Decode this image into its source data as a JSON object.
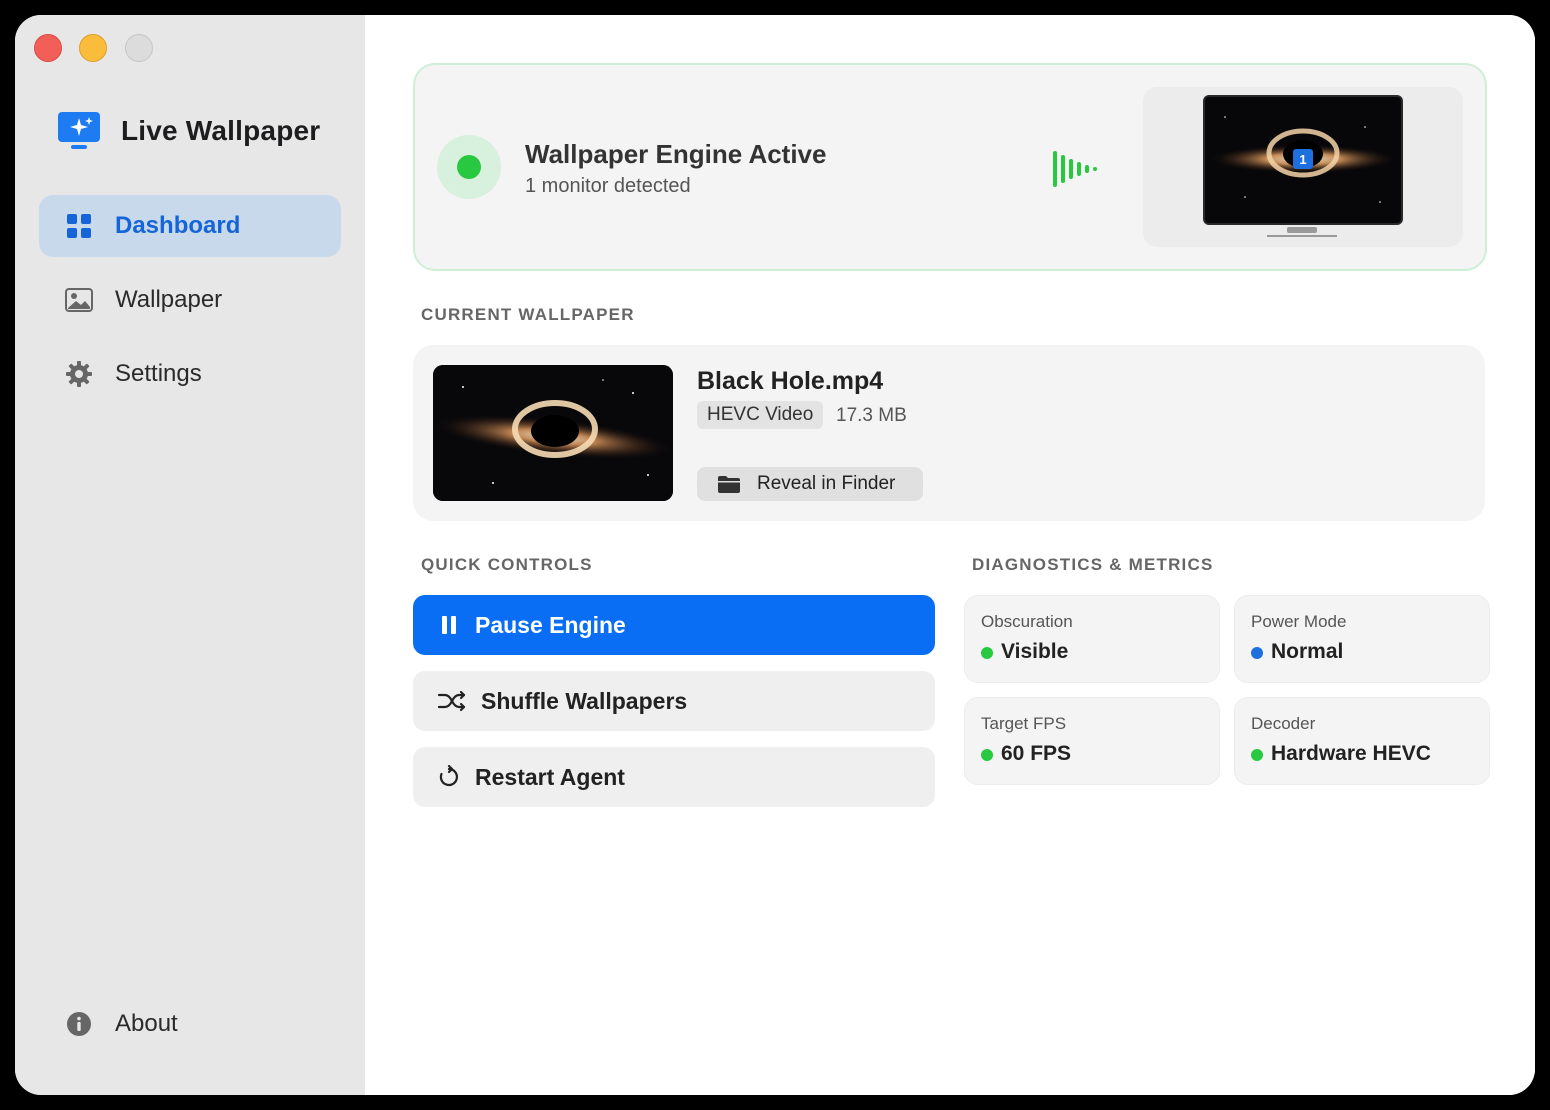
{
  "window": {
    "title": "Live Wallpaper"
  },
  "sidebar": {
    "app_title": "Live Wallpaper",
    "items": [
      {
        "label": "Dashboard",
        "icon": "grid-icon",
        "active": true
      },
      {
        "label": "Wallpaper",
        "icon": "photo-icon",
        "active": false
      },
      {
        "label": "Settings",
        "icon": "gear-icon",
        "active": false
      }
    ],
    "footer_item": {
      "label": "About",
      "icon": "info-icon"
    }
  },
  "status": {
    "title": "Wallpaper Engine Active",
    "subtitle": "1 monitor detected",
    "monitor_badge": "1",
    "color": "#28c840"
  },
  "current_wallpaper": {
    "section_label": "CURRENT WALLPAPER",
    "name": "Black Hole.mp4",
    "codec": "HEVC Video",
    "size": "17.3 MB",
    "reveal_label": "Reveal in Finder"
  },
  "quick_controls": {
    "section_label": "QUICK CONTROLS",
    "pause_label": "Pause Engine",
    "shuffle_label": "Shuffle Wallpapers",
    "restart_label": "Restart Agent"
  },
  "diagnostics": {
    "section_label": "DIAGNOSTICS & METRICS",
    "metrics": [
      {
        "label": "Obscuration",
        "value": "Visible",
        "color": "#28c840"
      },
      {
        "label": "Power Mode",
        "value": "Normal",
        "color": "#1e6fe0"
      },
      {
        "label": "Target FPS",
        "value": "60 FPS",
        "color": "#28c840"
      },
      {
        "label": "Decoder",
        "value": "Hardware HEVC",
        "color": "#28c840"
      }
    ]
  },
  "colors": {
    "accent": "#0a6ef5",
    "sidebar_active_bg": "#c9d9ec",
    "active_text": "#1565d8"
  }
}
